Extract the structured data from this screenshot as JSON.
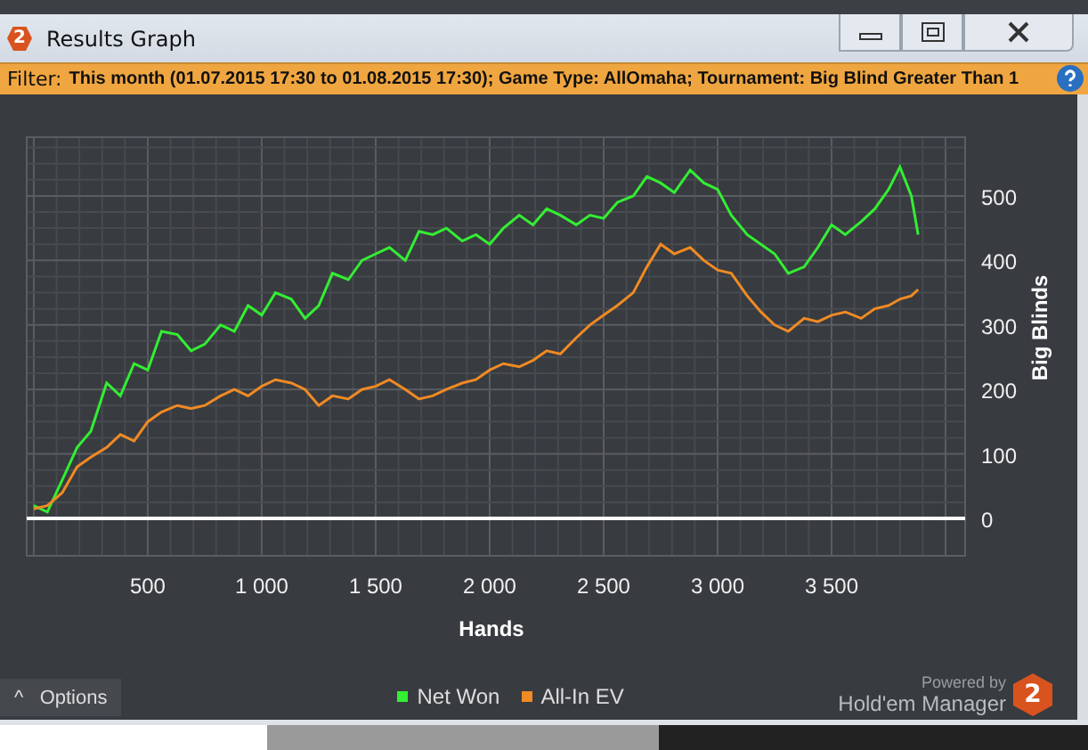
{
  "window": {
    "title": "Results Graph",
    "app_badge": "2"
  },
  "filter": {
    "label": "Filter:",
    "text": "This month (01.07.2015 17:30 to 01.08.2015 17:30); Game Type: AllOmaha; Tournament: Big Blind Greater Than 1"
  },
  "chart_data": {
    "type": "line",
    "grid": true,
    "xlabel": "Hands",
    "ylabel": "Big Blinds",
    "xlim": [
      -31,
      4086
    ],
    "ylim": [
      -58,
      591
    ],
    "x": [
      0,
      60,
      125,
      190,
      250,
      320,
      380,
      440,
      500,
      560,
      630,
      690,
      750,
      820,
      880,
      940,
      1000,
      1060,
      1130,
      1190,
      1250,
      1310,
      1380,
      1440,
      1500,
      1560,
      1630,
      1690,
      1750,
      1810,
      1880,
      1940,
      2000,
      2060,
      2130,
      2190,
      2250,
      2310,
      2380,
      2440,
      2500,
      2560,
      2630,
      2690,
      2750,
      2810,
      2880,
      2940,
      3000,
      3060,
      3130,
      3190,
      3250,
      3310,
      3380,
      3440,
      3500,
      3560,
      3630,
      3690,
      3750,
      3800,
      3850,
      3880
    ],
    "xticks": [
      {
        "value": 500,
        "label": "500"
      },
      {
        "value": 1000,
        "label": "1 000"
      },
      {
        "value": 1500,
        "label": "1 500"
      },
      {
        "value": 2000,
        "label": "2 000"
      },
      {
        "value": 2500,
        "label": "2 500"
      },
      {
        "value": 3000,
        "label": "3 000"
      },
      {
        "value": 3500,
        "label": "3 500"
      }
    ],
    "yticks": [
      0,
      100,
      200,
      300,
      400,
      500
    ],
    "series": [
      {
        "name": "Net Won",
        "color": "#33ee33",
        "values": [
          20,
          10,
          60,
          110,
          135,
          210,
          190,
          240,
          230,
          290,
          285,
          260,
          270,
          300,
          290,
          330,
          315,
          350,
          340,
          310,
          330,
          380,
          370,
          400,
          410,
          420,
          400,
          445,
          440,
          450,
          430,
          440,
          425,
          450,
          470,
          455,
          480,
          470,
          455,
          470,
          465,
          490,
          500,
          530,
          520,
          505,
          540,
          520,
          510,
          470,
          440,
          425,
          410,
          380,
          390,
          420,
          455,
          440,
          460,
          480,
          510,
          545,
          500,
          440
        ]
      },
      {
        "name": "All-In EV",
        "color": "#f08a24",
        "values": [
          15,
          20,
          40,
          80,
          95,
          110,
          130,
          120,
          150,
          165,
          175,
          170,
          175,
          190,
          200,
          190,
          205,
          215,
          210,
          200,
          175,
          190,
          185,
          200,
          205,
          215,
          200,
          185,
          190,
          200,
          210,
          215,
          230,
          240,
          235,
          245,
          260,
          255,
          280,
          300,
          315,
          330,
          350,
          390,
          425,
          410,
          420,
          400,
          385,
          380,
          345,
          320,
          300,
          290,
          310,
          305,
          315,
          320,
          310,
          325,
          330,
          340,
          345,
          355
        ]
      }
    ]
  },
  "footer": {
    "options": "Options",
    "options_icon": "^",
    "powered_by": "Powered by",
    "brand": "Hold'em Manager",
    "brand_badge": "2"
  }
}
